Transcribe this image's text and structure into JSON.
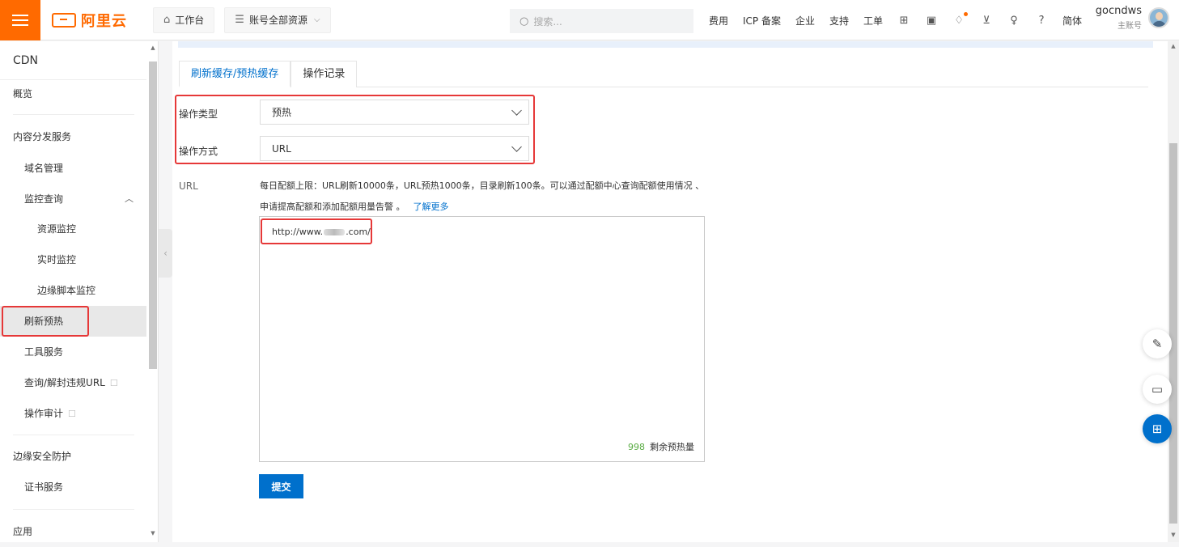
{
  "header": {
    "logo_text": "阿里云",
    "workbench_label": "工作台",
    "resources_label": "账号全部资源",
    "search_placeholder": "搜索...",
    "links": [
      "费用",
      "ICP 备案",
      "企业",
      "支持",
      "工单"
    ],
    "icons": [
      "apps-icon",
      "terminal-icon",
      "bell-icon",
      "cart-icon",
      "lightbulb-icon",
      "help-icon"
    ],
    "language": "简体",
    "user_name": "gocndws",
    "user_role": "主账号",
    "accent_color": "#ff6a00"
  },
  "sidebar": {
    "title": "CDN",
    "overview": "概览",
    "content_delivery": "内容分发服务",
    "domain_mgmt": "域名管理",
    "monitoring": "监控查询",
    "resource_monitoring": "资源监控",
    "realtime_monitoring": "实时监控",
    "edge_script_monitoring": "边缘脚本监控",
    "refresh_preload": "刷新预热",
    "tools": "工具服务",
    "url_query": "查询/解封违规URL",
    "audit": "操作审计",
    "edge_security": "边缘安全防护",
    "cert_service": "证书服务",
    "apps": "应用",
    "external_icon": "☐"
  },
  "main": {
    "tabs": [
      "刷新缓存/预热缓存",
      "操作记录"
    ],
    "op_type_label": "操作类型",
    "op_type_value": "预热",
    "op_method_label": "操作方式",
    "op_method_value": "URL",
    "url_label": "URL",
    "hint_line1": "每日配额上限：URL刷新10000条，URL预热1000条，目录刷新100条。可以通过配额中心查询配额使用情况 、",
    "hint_line2": "申请提高配额和添加配额用量告警 。",
    "learn_more": "了解更多",
    "url_prefix": "http://www.",
    "url_suffix": ".com/",
    "remaining_count": "998",
    "remaining_label": "剩余预热量",
    "submit_label": "提交",
    "primary_color": "#0070cc"
  }
}
